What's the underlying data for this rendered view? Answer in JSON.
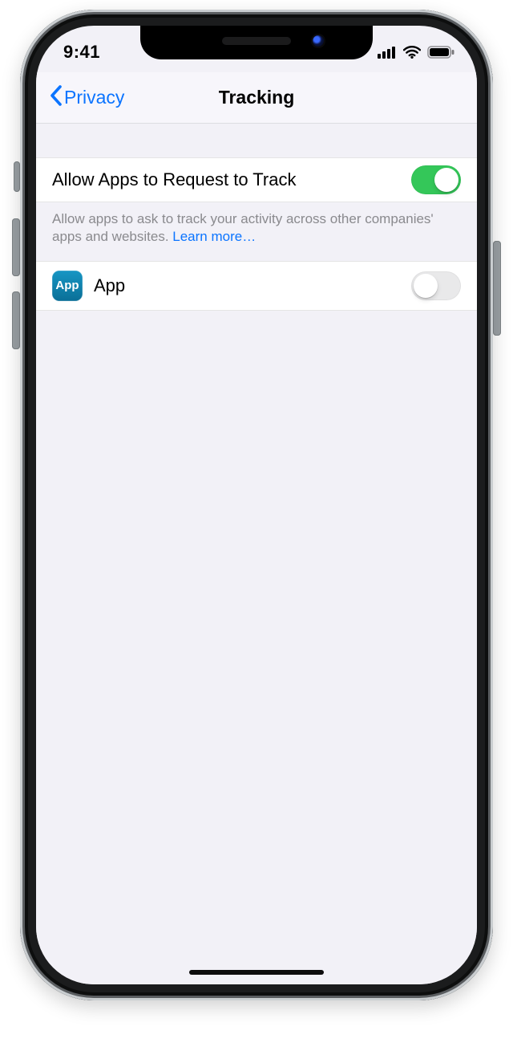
{
  "status": {
    "time": "9:41"
  },
  "nav": {
    "back_label": "Privacy",
    "title": "Tracking"
  },
  "tracking": {
    "allow_label": "Allow Apps to Request to Track",
    "allow_on": true,
    "footer_text": "Allow apps to ask to track your activity across other companies' apps and websites. ",
    "learn_more_label": "Learn more…"
  },
  "apps": [
    {
      "icon_text": "App",
      "name": "App",
      "on": false
    }
  ],
  "colors": {
    "accent": "#0b74ff",
    "switch_on": "#34c759",
    "bg": "#f2f1f7"
  }
}
